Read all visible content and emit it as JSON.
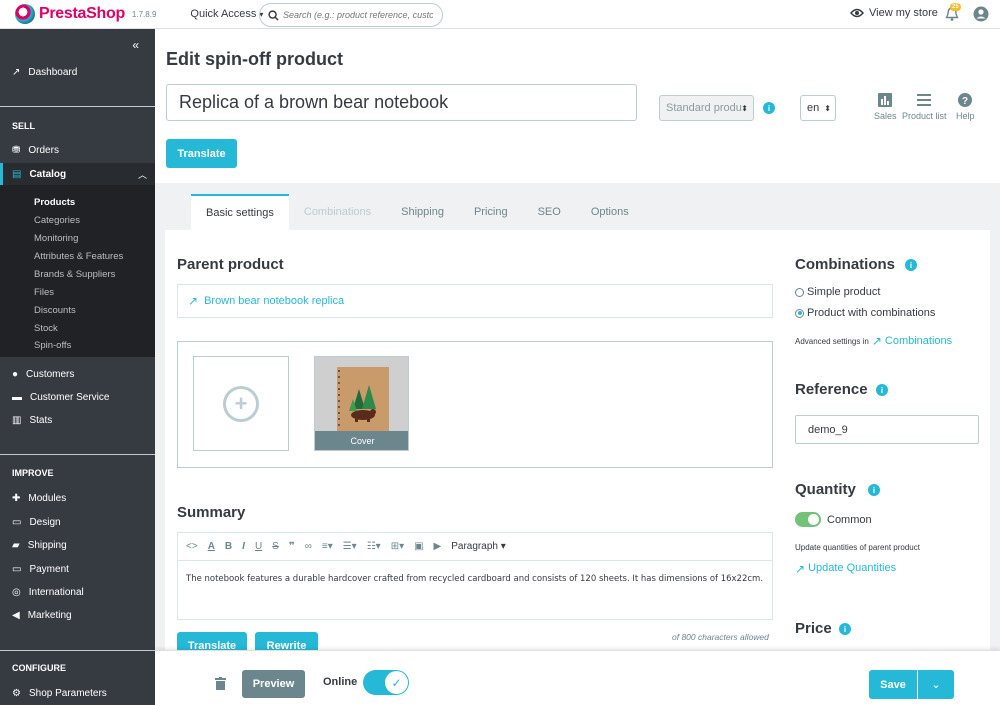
{
  "topbar": {
    "brand": "PrestaShop",
    "version": "1.7.8.9",
    "quick_access": "Quick Access",
    "search_placeholder": "Search (e.g.: product reference, custon",
    "view_store": "View my store",
    "notif_count": "25"
  },
  "sidebar": {
    "dashboard": "Dashboard",
    "sec_sell": "SELL",
    "orders": "Orders",
    "catalog": "Catalog",
    "sub": [
      "Products",
      "Categories",
      "Monitoring",
      "Attributes & Features",
      "Brands & Suppliers",
      "Files",
      "Discounts",
      "Stock",
      "Spin-offs"
    ],
    "customers": "Customers",
    "customer_service": "Customer Service",
    "stats": "Stats",
    "sec_improve": "IMPROVE",
    "modules": "Modules",
    "design": "Design",
    "shipping": "Shipping",
    "payment": "Payment",
    "international": "International",
    "marketing": "Marketing",
    "sec_configure": "CONFIGURE",
    "shop_parameters": "Shop Parameters"
  },
  "header": {
    "title": "Edit spin-off product",
    "product_name": "Replica of a brown bear notebook",
    "product_type": "Standard produ",
    "lang": "en",
    "sales": "Sales",
    "product_list": "Product list",
    "help": "Help",
    "translate": "Translate"
  },
  "tabs": [
    "Basic settings",
    "Combinations",
    "Shipping",
    "Pricing",
    "SEO",
    "Options"
  ],
  "left": {
    "parent_title": "Parent product",
    "parent_link": "Brown bear notebook replica",
    "cover_label": "Cover",
    "summary_title": "Summary",
    "paragraph": "Paragraph",
    "summary_text": "The notebook features a durable hardcover crafted from recycled cardboard and consists of 120 sheets. It has dimensions of 16x22cm.",
    "translate": "Translate",
    "rewrite": "Rewrite",
    "counter": "of 800 characters allowed"
  },
  "right": {
    "combinations_title": "Combinations",
    "simple_product": "Simple product",
    "with_combinations": "Product with combinations",
    "advanced_prefix": "Advanced settings in",
    "advanced_link": "Combinations",
    "reference_title": "Reference",
    "reference_value": "demo_9",
    "quantity_title": "Quantity",
    "common": "Common",
    "update_note": "Update quantities of parent product",
    "update_link": "Update Quantities",
    "price_title": "Price"
  },
  "footer": {
    "preview": "Preview",
    "online": "Online",
    "save": "Save"
  },
  "colors": {
    "accent": "#25b9d7",
    "sidebar": "#363a41",
    "brand": "#df0067",
    "toggle_on": "#72c279"
  }
}
